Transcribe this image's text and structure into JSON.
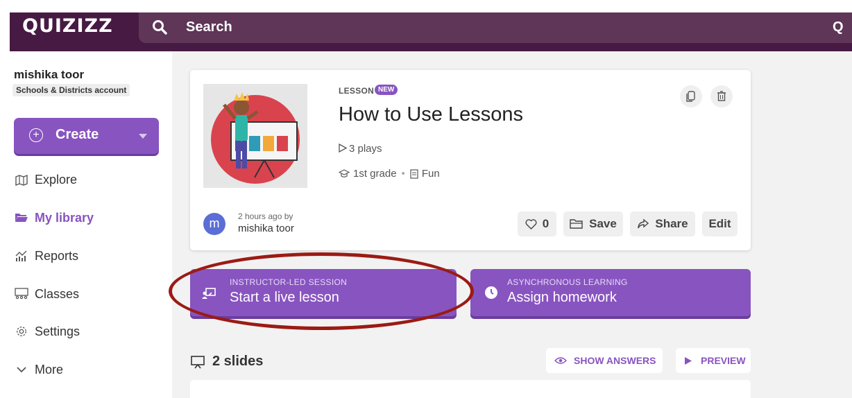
{
  "app": {
    "logo": "QUIZIZZ"
  },
  "search": {
    "label": "Search",
    "edge_text": "Q"
  },
  "user": {
    "name": "mishika toor",
    "account_type": "Schools & Districts account"
  },
  "create_button": {
    "label": "Create"
  },
  "nav": {
    "explore": "Explore",
    "my_library": "My library",
    "reports": "Reports",
    "classes": "Classes",
    "settings": "Settings",
    "more": "More"
  },
  "lesson": {
    "type": "LESSON",
    "badge": "NEW",
    "title": "How to Use Lessons",
    "plays": "3 plays",
    "grade": "1st grade",
    "subject": "Fun",
    "author_time": "2 hours ago by",
    "author_name": "mishika toor",
    "avatar_letter": "m",
    "likes": "0",
    "save_label": "Save",
    "share_label": "Share",
    "edit_label": "Edit"
  },
  "sessions": {
    "live": {
      "eyebrow": "INSTRUCTOR-LED SESSION",
      "title": "Start a live lesson"
    },
    "async": {
      "eyebrow": "ASYNCHRONOUS LEARNING",
      "title": "Assign homework"
    }
  },
  "slides": {
    "count_label": "2 slides",
    "show_answers": "SHOW ANSWERS",
    "preview": "PREVIEW"
  },
  "colors": {
    "brand": "#461a42",
    "accent": "#8854c0",
    "highlight_oval": "#9b1b14"
  }
}
